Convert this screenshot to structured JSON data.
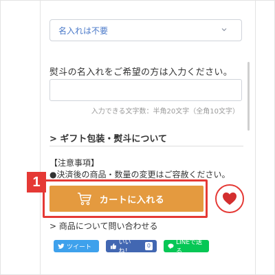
{
  "name_select": {
    "value": "名入れは不要"
  },
  "name_label": "熨斗の名入れをご希望の方は入力ください。",
  "name_input": {
    "value": "",
    "placeholder": ""
  },
  "name_hint": "入力できる文字数：半角20文字（全角10文字）",
  "gift_link": "> ギフト包装・熨斗について",
  "notice": {
    "title": "【注意事項】",
    "body": "●決済後の商品・数量の変更はご容赦ください。"
  },
  "badge": "1",
  "cart_button": {
    "label": "カートに入れる",
    "icon": "cart-icon"
  },
  "favorite_button": {
    "icon": "heart-icon"
  },
  "inquiry_link": "> 商品について問い合わせる",
  "share": {
    "tweet": "ツイート",
    "like": "いいね！",
    "like_count": "0",
    "line": "LINEで送る"
  },
  "colors": {
    "accent_orange": "#e49a3f",
    "highlight_red": "#e53935",
    "twitter": "#3ea1ec",
    "facebook": "#4267b2",
    "line": "#06c755",
    "select_text": "#4a79c9"
  }
}
